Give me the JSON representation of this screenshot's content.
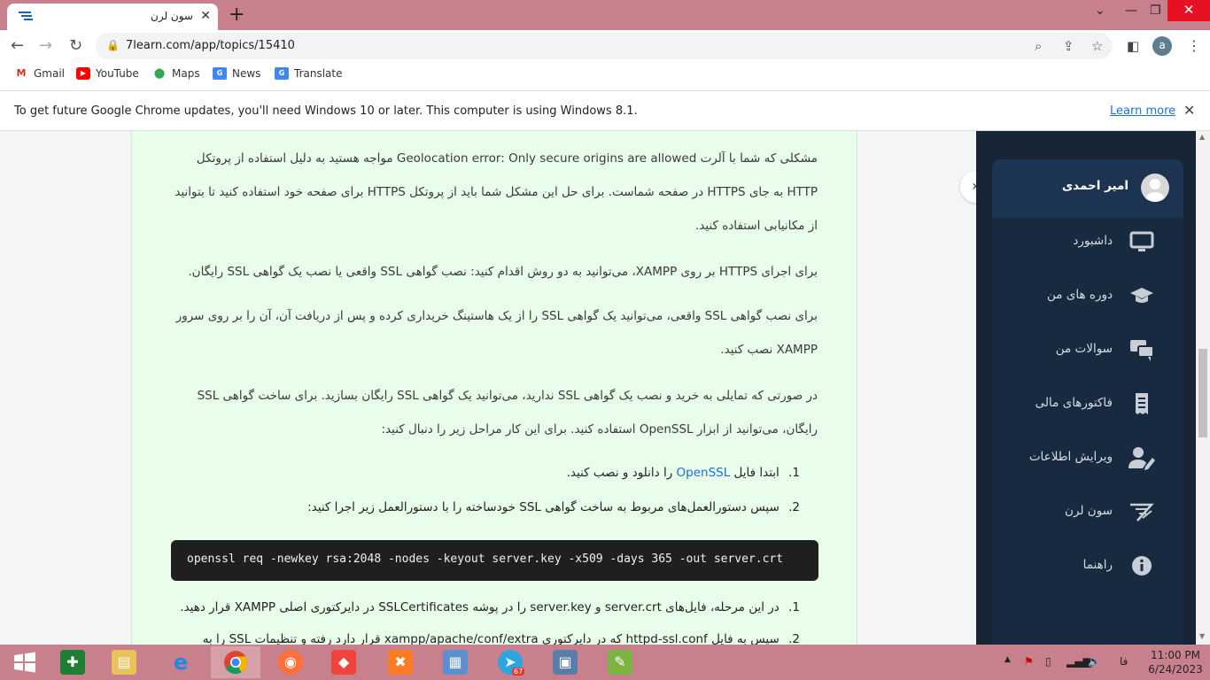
{
  "browser": {
    "tab_title": "سون لرن",
    "url": "7learn.com/app/topics/15410",
    "profile_initial": "a"
  },
  "bookmarks": [
    {
      "label": "Gmail",
      "icon": "gmail-icon"
    },
    {
      "label": "YouTube",
      "icon": "youtube-icon"
    },
    {
      "label": "Maps",
      "icon": "maps-icon"
    },
    {
      "label": "News",
      "icon": "news-icon"
    },
    {
      "label": "Translate",
      "icon": "translate-icon"
    }
  ],
  "infobar": {
    "message": "To get future Google Chrome updates, you'll need Windows 10 or later. This computer is using Windows 8.1.",
    "link": "Learn more"
  },
  "article": {
    "p1": "مشکلی که شما با آلرت Geolocation error: Only secure origins are allowed مواجه هستید به دلیل استفاده از پروتکل HTTP به جای HTTPS در صفحه شماست. برای حل این مشکل شما باید از پروتکل HTTPS برای صفحه خود استفاده کنید تا بتوانید از مکانیابی استفاده کنید.",
    "p2": "برای اجرای HTTPS بر روی XAMPP، می‌توانید به دو روش اقدام کنید: نصب گواهی SSL واقعی یا نصب یک گواهی SSL رایگان.",
    "p3": "برای نصب گواهی SSL واقعی، می‌توانید یک گواهی SSL را از یک هاستینگ خریداری کرده و پس از دریافت آن، آن را بر روی سرور XAMPP نصب کنید.",
    "p4": "در صورتی که تمایلی به خرید و نصب یک گواهی SSL ندارید، می‌توانید یک گواهی SSL رایگان بسازید. برای ساخت گواهی SSL رایگان، می‌توانید از ابزار OpenSSL استفاده کنید. برای این کار مراحل زیر را دنبال کنید:",
    "step1_num": "1.",
    "step1_pre": "ابتدا فایل",
    "step1_link": "OpenSSL",
    "step1_post": "را دانلود و نصب کنید.",
    "step2_num": "2.",
    "step2": "سپس دستورالعمل‌های مربوط به ساخت گواهی SSL خودساخته را با دستورالعمل زیر اجرا کنید:",
    "code": "openssl req -newkey rsa:2048 -nodes -keyout server.key -x509 -days 365 -out server.crt",
    "step3_num": "1.",
    "step3": "در این مرحله، فایل‌های server.crt و server.key را در پوشه SSLCertificates در دایرکتوری اصلی XAMPP قرار دهید.",
    "step4_num": "2.",
    "step4": "سپس به فایل httpd-ssl.conf که در دایرکتوری xampp/apache/conf/extra قرار دارد رفته و تنظیمات SSL را به"
  },
  "sidebar": {
    "user_name": "امیر احمدی",
    "items": [
      {
        "label": "داشبورد",
        "icon": "monitor-icon"
      },
      {
        "label": "دوره های من",
        "icon": "graduation-cap-icon"
      },
      {
        "label": "سوالات من",
        "icon": "chat-bubbles-icon"
      },
      {
        "label": "فاکتورهای مالی",
        "icon": "receipt-icon"
      },
      {
        "label": "ویرایش اطلاعات",
        "icon": "user-edit-icon"
      },
      {
        "label": "سون لرن",
        "icon": "7learn-logo-icon"
      },
      {
        "label": "راهنما",
        "icon": "info-icon"
      }
    ]
  },
  "taskbar": {
    "telegram_badge": "67",
    "lang": "فا",
    "time": "11:00 PM",
    "date": "6/24/2023"
  },
  "colors": {
    "titlebar": "#c8818c",
    "sidebar_bg": "#162436",
    "article_bg": "#e8fdea",
    "link": "#1a6fd6"
  }
}
